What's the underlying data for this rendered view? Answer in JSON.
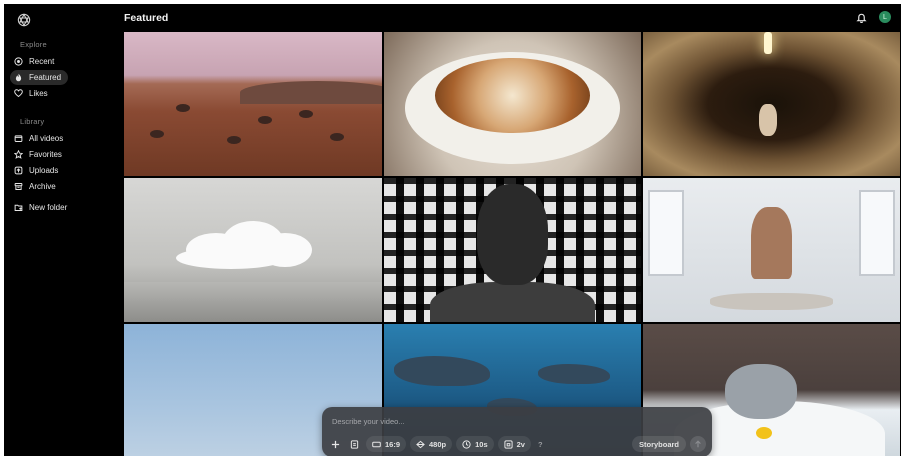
{
  "app": {
    "logo_icon": "openai-knot-icon"
  },
  "sidebar": {
    "explore_title": "Explore",
    "explore_items": [
      {
        "label": "Recent",
        "icon": "clock-icon"
      },
      {
        "label": "Featured",
        "icon": "flame-icon",
        "active": true
      },
      {
        "label": "Likes",
        "icon": "heart-icon"
      }
    ],
    "library_title": "Library",
    "library_items": [
      {
        "label": "All videos",
        "icon": "folder-icon"
      },
      {
        "label": "Favorites",
        "icon": "star-icon"
      },
      {
        "label": "Uploads",
        "icon": "upload-icon"
      },
      {
        "label": "Archive",
        "icon": "archive-icon"
      }
    ],
    "new_folder": {
      "label": "New folder",
      "icon": "folder-plus-icon"
    }
  },
  "header": {
    "title": "Featured",
    "bell_icon": "bell-icon",
    "avatar_initial": "L",
    "avatar_color": "#2a8c5e"
  },
  "grid": {
    "tiles": [
      "martian-desert",
      "latte-art",
      "mouse-in-cave",
      "cloud-in-room",
      "portrait-shadows",
      "yoga-man",
      "blue-sky",
      "sharks-underwater",
      "koala-bath"
    ]
  },
  "composer": {
    "placeholder": "Describe your video...",
    "aspect": "16:9",
    "resolution": "480p",
    "duration": "10s",
    "variations": "2v",
    "help": "?",
    "storyboard": "Storyboard"
  }
}
